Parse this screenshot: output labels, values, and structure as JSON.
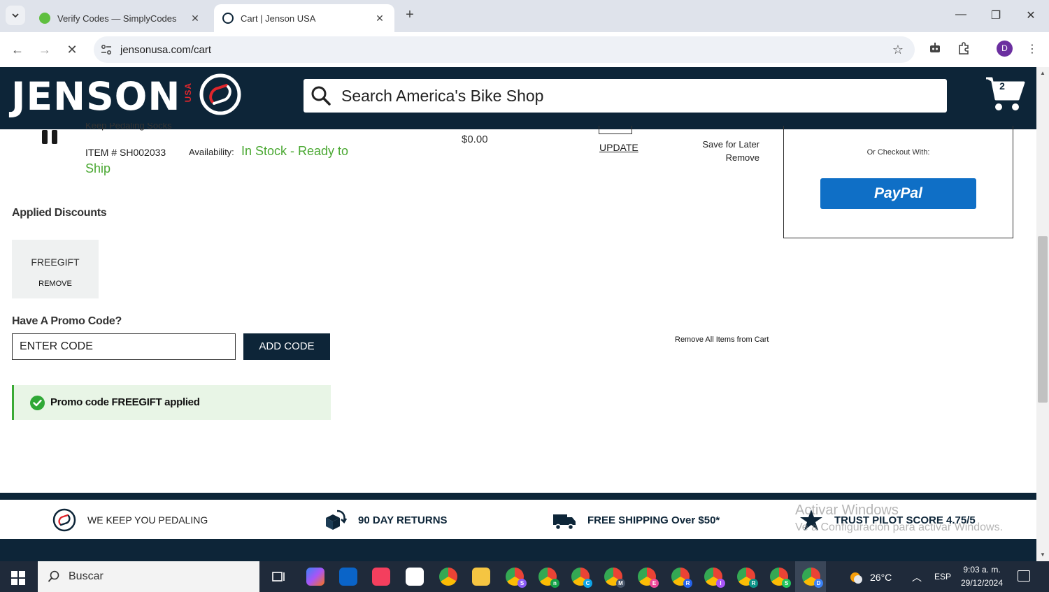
{
  "browser": {
    "tabs": [
      {
        "title": "Verify Codes — SimplyCodes",
        "active": false
      },
      {
        "title": "Cart | Jenson USA",
        "active": true
      }
    ],
    "url": "jensonusa.com/cart",
    "profile_initial": "D"
  },
  "header": {
    "logo_text": "JENSON",
    "logo_sub": "USA",
    "search_placeholder": "Search America's Bike Shop",
    "cart_count": "2"
  },
  "cart_item": {
    "name_partial": "Keep Pedaling Socks",
    "item_number": "ITEM # SH002033",
    "availability_label": "Availability:",
    "availability_value_1": "In Stock - Ready to",
    "availability_value_2": "Ship",
    "price": "$0.00",
    "update_label": "UPDATE",
    "save_later_label": "Save for Later",
    "remove_label": "Remove"
  },
  "checkout": {
    "or_checkout_label": "Or Checkout With:",
    "paypal_label": "PayPal"
  },
  "discounts": {
    "title": "Applied Discounts",
    "code": "FREEGIFT",
    "remove_label": "REMOVE"
  },
  "promo": {
    "title": "Have A Promo Code?",
    "placeholder": "ENTER CODE",
    "add_label": "ADD CODE",
    "applied_message": "Promo code FREEGIFT applied",
    "remove_all_label": "Remove All Items from Cart"
  },
  "footer": {
    "features": [
      {
        "text": "WE KEEP YOU PEDALING",
        "icon": "pedal-logo-icon"
      },
      {
        "text": "90 DAY RETURNS",
        "icon": "box-return-icon"
      },
      {
        "text": "FREE SHIPPING Over $50*",
        "icon": "truck-icon"
      },
      {
        "text": "TRUST PILOT SCORE 4.75/5",
        "icon": "star-icon"
      }
    ]
  },
  "watermark": {
    "line1": "Activar Windows",
    "line2": "Ve a Configuración para activar Windows."
  },
  "taskbar": {
    "search_label": "Buscar",
    "weather": "26°C",
    "language": "ESP",
    "time": "9:03 a. m.",
    "date": "29/12/2024",
    "chrome_profiles": [
      "S",
      "n",
      "C",
      "M",
      "E",
      "R",
      "I",
      "R",
      "S",
      "D"
    ]
  }
}
